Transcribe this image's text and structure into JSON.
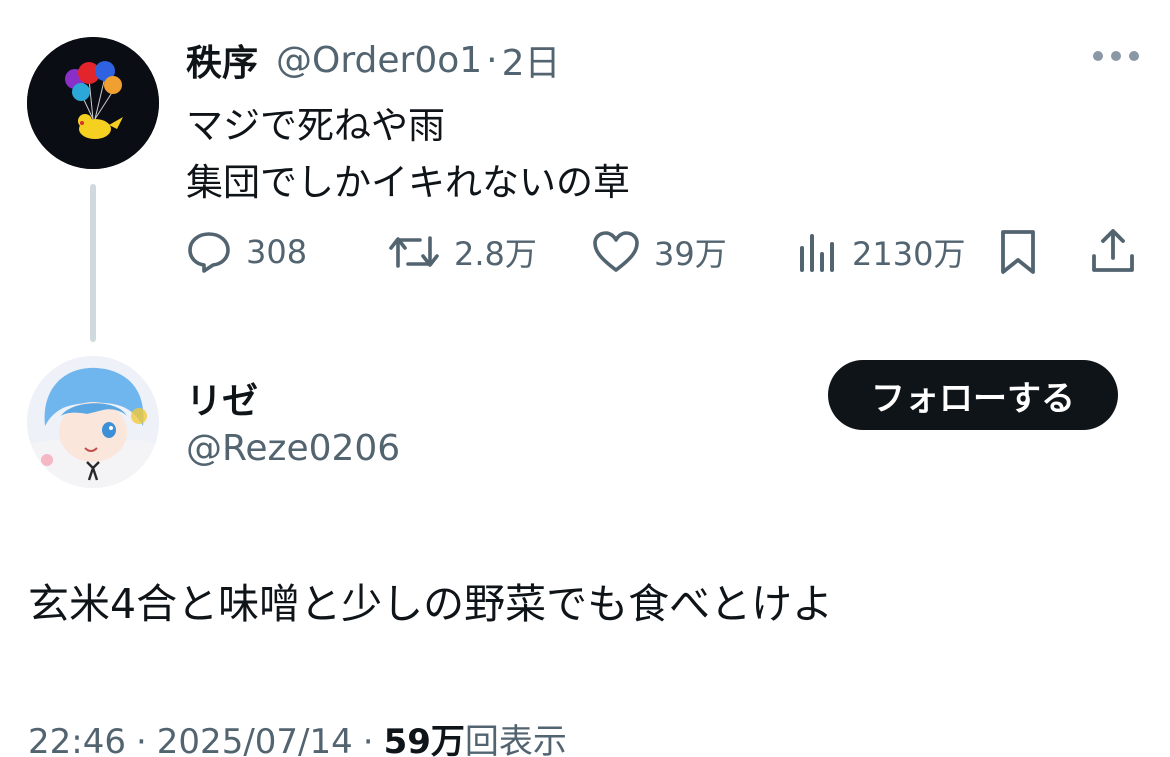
{
  "parent_tweet": {
    "display_name": "秩序",
    "handle": "@Order0o1",
    "separator": "·",
    "time": "2日",
    "lines": [
      "マジで死ねや雨",
      "集団でしかイキれないの草"
    ],
    "actions": {
      "replies": "308",
      "retweets": "2.8万",
      "likes": "39万",
      "views": "2130万"
    },
    "avatar_icon": "pikachu-balloons-avatar"
  },
  "reply": {
    "display_name": "リゼ",
    "handle": "@Reze0206",
    "follow_label": "フォローする",
    "body": "玄米4合と味噌と少しの野菜でも食べとけよ",
    "avatar_icon": "anime-girl-avatar"
  },
  "meta": {
    "time": "22:46",
    "date": "2025/07/14",
    "separator": "·",
    "views_count": "59万",
    "views_label": "回表示"
  },
  "colors": {
    "text": "#0f1419",
    "secondary": "#536471",
    "thread_line": "#cfd9de",
    "follow_bg": "#0f1419"
  }
}
